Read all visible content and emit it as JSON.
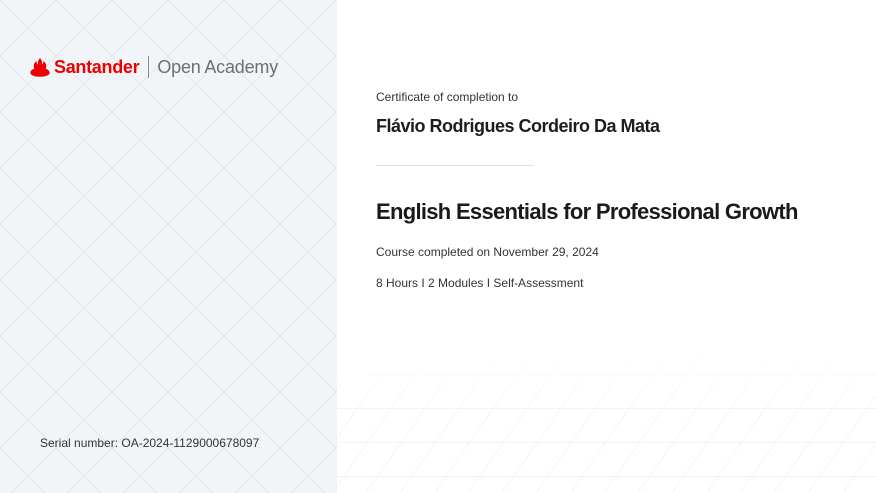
{
  "header": {
    "brand_name": "Santander",
    "sub_brand": "Open Academy",
    "logo_icon": "flame-icon",
    "brand_color": "#ec0000"
  },
  "certificate": {
    "label": "Certificate of completion to",
    "recipient": "Flávio Rodrigues Cordeiro Da Mata",
    "course_title": "English Essentials for Professional Growth",
    "completion": "Course completed on November 29, 2024",
    "details": "8 Hours I 2 Modules I Self-Assessment"
  },
  "footer": {
    "serial": "Serial number: OA-2024-1129000678097"
  },
  "colors": {
    "left_panel_bg": "#f1f5f8",
    "pattern_line": "#dfe6ec"
  }
}
